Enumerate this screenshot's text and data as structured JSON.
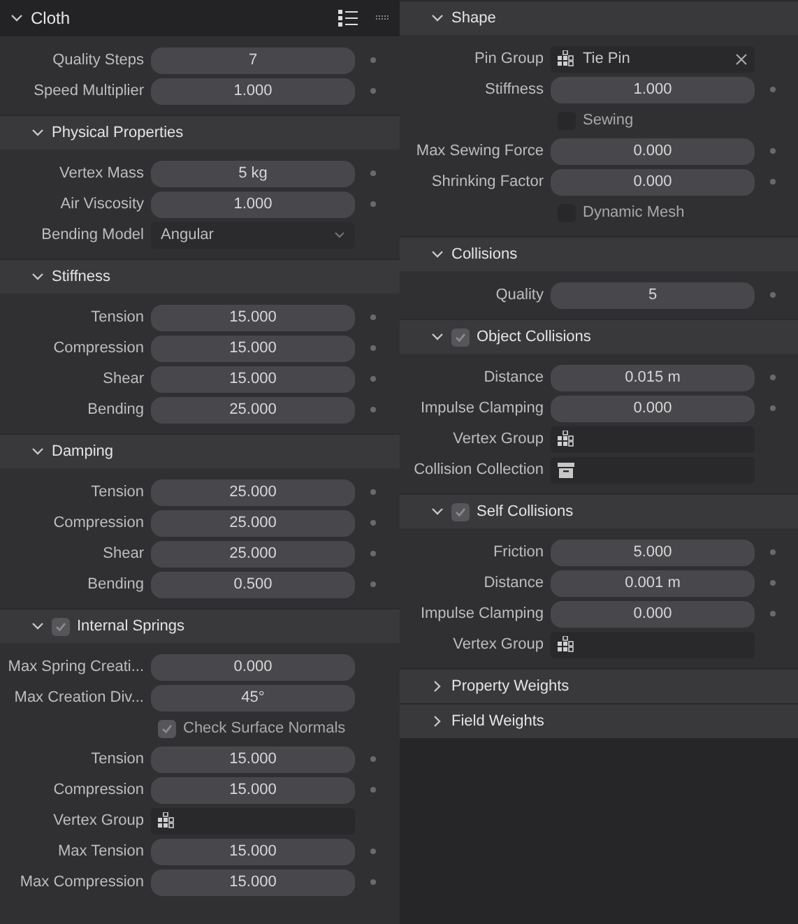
{
  "left": {
    "panel": {
      "title": "Cloth",
      "expanded": true,
      "rows": [
        {
          "kind": "number",
          "label": "Quality Steps",
          "value": "7",
          "animatable": true
        },
        {
          "kind": "number",
          "label": "Speed Multiplier",
          "value": "1.000",
          "animatable": true
        }
      ]
    },
    "sections": [
      {
        "title": "Physical Properties",
        "expanded": true,
        "rows": [
          {
            "kind": "number",
            "label": "Vertex Mass",
            "value": "5 kg",
            "animatable": true
          },
          {
            "kind": "number",
            "label": "Air Viscosity",
            "value": "1.000",
            "animatable": true
          },
          {
            "kind": "dropdown",
            "label": "Bending Model",
            "value": "Angular"
          }
        ]
      },
      {
        "title": "Stiffness",
        "expanded": true,
        "rows": [
          {
            "kind": "number",
            "label": "Tension",
            "value": "15.000",
            "animatable": true
          },
          {
            "kind": "number",
            "label": "Compression",
            "value": "15.000",
            "animatable": true
          },
          {
            "kind": "number",
            "label": "Shear",
            "value": "15.000",
            "animatable": true
          },
          {
            "kind": "number",
            "label": "Bending",
            "value": "25.000",
            "animatable": true
          }
        ]
      },
      {
        "title": "Damping",
        "expanded": true,
        "rows": [
          {
            "kind": "number",
            "label": "Tension",
            "value": "25.000",
            "animatable": true
          },
          {
            "kind": "number",
            "label": "Compression",
            "value": "25.000",
            "animatable": true
          },
          {
            "kind": "number",
            "label": "Shear",
            "value": "25.000",
            "animatable": true
          },
          {
            "kind": "number",
            "label": "Bending",
            "value": "0.500",
            "animatable": true
          }
        ]
      },
      {
        "title": "Internal Springs",
        "expanded": true,
        "checked": true,
        "rows": [
          {
            "kind": "number",
            "label": "Max Spring Creati...",
            "value": "0.000",
            "animatable": false
          },
          {
            "kind": "number",
            "label": "Max Creation Div...",
            "value": "45°",
            "animatable": false
          },
          {
            "kind": "checkbox",
            "label": "Check Surface Normals",
            "checked": true
          },
          {
            "kind": "number",
            "label": "Tension",
            "value": "15.000",
            "animatable": true
          },
          {
            "kind": "number",
            "label": "Compression",
            "value": "15.000",
            "animatable": true
          },
          {
            "kind": "vertex_group",
            "label": "Vertex Group"
          },
          {
            "kind": "number",
            "label": "Max Tension",
            "value": "15.000",
            "animatable": true
          },
          {
            "kind": "number",
            "label": "Max Compression",
            "value": "15.000",
            "animatable": true
          }
        ]
      }
    ]
  },
  "right": {
    "sections": [
      {
        "title": "Shape",
        "expanded": true,
        "rows": [
          {
            "kind": "vertex_group",
            "label": "Pin Group",
            "value": "Tie Pin"
          },
          {
            "kind": "number",
            "label": "Stiffness",
            "value": "1.000",
            "animatable": true
          },
          {
            "kind": "checkbox",
            "label": "Sewing",
            "checked": false
          },
          {
            "kind": "number",
            "label": "Max Sewing Force",
            "value": "0.000",
            "animatable": true
          },
          {
            "kind": "number",
            "label": "Shrinking Factor",
            "value": "0.000",
            "animatable": true
          },
          {
            "kind": "checkbox",
            "label": "Dynamic Mesh",
            "checked": false
          }
        ]
      },
      {
        "title": "Collisions",
        "expanded": true,
        "rows": [
          {
            "kind": "number",
            "label": "Quality",
            "value": "5",
            "animatable": true
          }
        ]
      },
      {
        "title": "Object Collisions",
        "expanded": true,
        "checked": true,
        "rows": [
          {
            "kind": "number",
            "label": "Distance",
            "value": "0.015 m",
            "animatable": true
          },
          {
            "kind": "number",
            "label": "Impulse Clamping",
            "value": "0.000",
            "animatable": true
          },
          {
            "kind": "vertex_group",
            "label": "Vertex Group"
          },
          {
            "kind": "collection",
            "label": "Collision Collection"
          }
        ]
      },
      {
        "title": "Self Collisions",
        "expanded": true,
        "checked": true,
        "rows": [
          {
            "kind": "number",
            "label": "Friction",
            "value": "5.000",
            "animatable": true
          },
          {
            "kind": "number",
            "label": "Distance",
            "value": "0.001 m",
            "animatable": true
          },
          {
            "kind": "number",
            "label": "Impulse Clamping",
            "value": "0.000",
            "animatable": true
          },
          {
            "kind": "vertex_group",
            "label": "Vertex Group"
          }
        ]
      },
      {
        "title": "Property Weights",
        "expanded": false
      },
      {
        "title": "Field Weights",
        "expanded": false
      }
    ]
  }
}
